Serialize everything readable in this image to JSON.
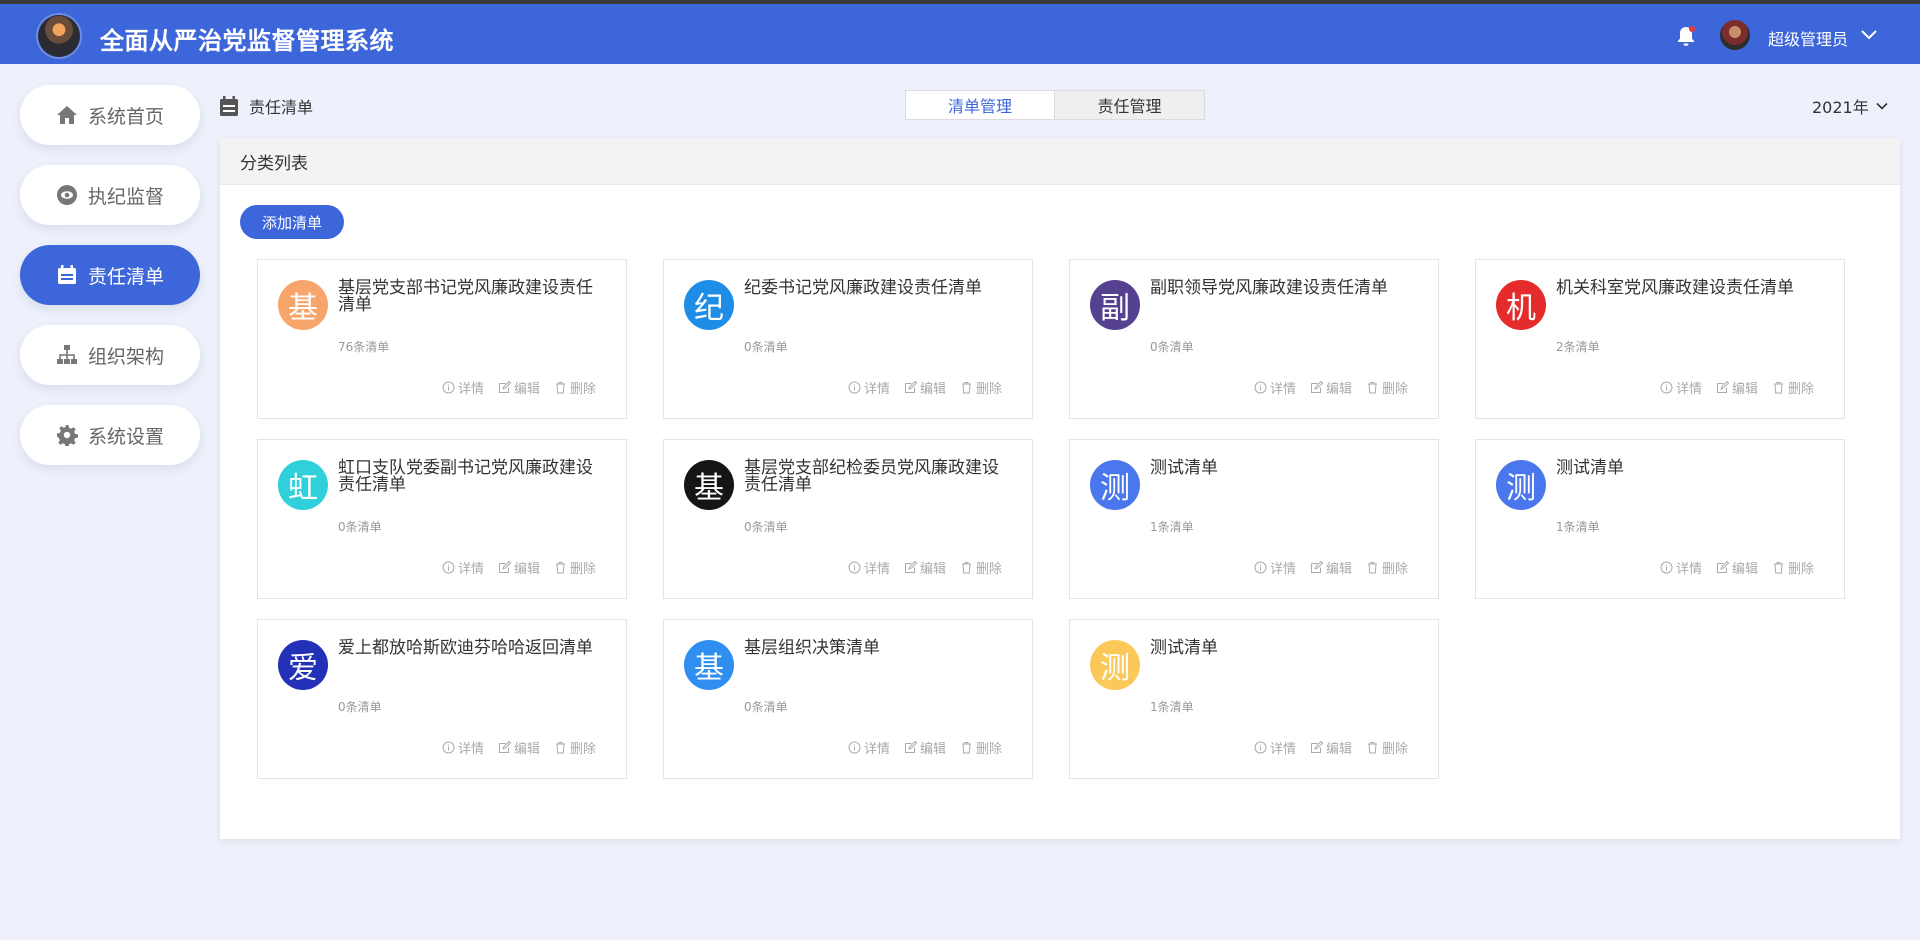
{
  "app": {
    "title": "全面从严治党监督管理系统",
    "user": "超级管理员"
  },
  "sidebar": {
    "items": [
      {
        "label": "系统首页",
        "icon": "home-icon"
      },
      {
        "label": "执纪监督",
        "icon": "eye-icon"
      },
      {
        "label": "责任清单",
        "icon": "calendar-icon",
        "active": true
      },
      {
        "label": "组织架构",
        "icon": "org-chart-icon"
      },
      {
        "label": "系统设置",
        "icon": "gear-icon"
      }
    ]
  },
  "breadcrumb": {
    "label": "责任清单"
  },
  "tabs": [
    {
      "label": "清单管理",
      "active": true
    },
    {
      "label": "责任管理"
    }
  ],
  "year_selector": {
    "value": "2021年"
  },
  "panel": {
    "title": "分类列表",
    "add_button": "添加清单"
  },
  "actions": {
    "detail": "详情",
    "edit": "编辑",
    "delete": "删除"
  },
  "cards": [
    {
      "char": "基",
      "color": "#f7a56b",
      "title": "基层党支部书记党风廉政建设责任清单",
      "count": "76条清单"
    },
    {
      "char": "纪",
      "color": "#1f8de8",
      "title": "纪委书记党风廉政建设责任清单",
      "count": "0条清单"
    },
    {
      "char": "副",
      "color": "#55418f",
      "title": "副职领导党风廉政建设责任清单",
      "count": "0条清单"
    },
    {
      "char": "机",
      "color": "#e52b2b",
      "title": "机关科室党风廉政建设责任清单",
      "count": "2条清单"
    },
    {
      "char": "虹",
      "color": "#2fd0da",
      "title": "虹口支队党委副书记党风廉政建设责任清单",
      "count": "0条清单"
    },
    {
      "char": "基",
      "color": "#151515",
      "title": "基层党支部纪检委员党风廉政建设责任清单",
      "count": "0条清单"
    },
    {
      "char": "测",
      "color": "#4a76ee",
      "title": "测试清单",
      "count": "1条清单"
    },
    {
      "char": "测",
      "color": "#4a76ee",
      "title": "测试清单",
      "count": "1条清单"
    },
    {
      "char": "爱",
      "color": "#2330b8",
      "title": "爱上都放哈斯欧迪芬哈哈返回清单",
      "count": "0条清单"
    },
    {
      "char": "基",
      "color": "#2f8ef0",
      "title": "基层组织决策清单",
      "count": "0条清单"
    },
    {
      "char": "测",
      "color": "#fbc959",
      "title": "测试清单",
      "count": "1条清单"
    }
  ]
}
